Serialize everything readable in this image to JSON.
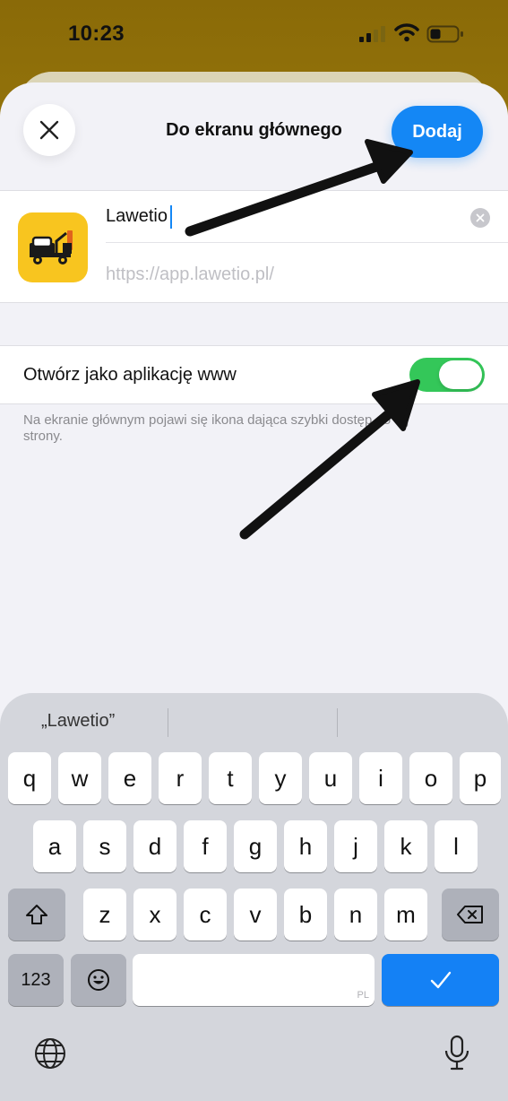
{
  "status_bar": {
    "time": "10:23",
    "signal_icon": "cellular-signal-icon",
    "wifi_icon": "wifi-icon",
    "battery_icon": "battery-icon",
    "battery_level": 0.3
  },
  "header": {
    "title": "Do ekranu głównego",
    "add_label": "Dodaj",
    "close_icon": "close-icon"
  },
  "app": {
    "icon": "tow-truck-icon",
    "name_value": "Lawetio",
    "url": "https://app.lawetio.pl/"
  },
  "toggle": {
    "label": "Otwórz jako aplikację www",
    "state": "on",
    "hint": "Na ekranie głównym pojawi się ikona dająca szybki dostęp do tej strony."
  },
  "keyboard": {
    "suggestions": [
      "„Lawetio”",
      "",
      ""
    ],
    "row1": [
      "q",
      "w",
      "e",
      "r",
      "t",
      "y",
      "u",
      "i",
      "o",
      "p"
    ],
    "row2": [
      "a",
      "s",
      "d",
      "f",
      "g",
      "h",
      "j",
      "k",
      "l"
    ],
    "row3": [
      "z",
      "x",
      "c",
      "v",
      "b",
      "n",
      "m"
    ],
    "numbers_label": "123",
    "space_tag": "PL",
    "shift_icon": "shift-icon",
    "backspace_icon": "backspace-icon",
    "emoji_icon": "emoji-icon",
    "return_icon": "checkmark-icon",
    "globe_icon": "globe-icon",
    "mic_icon": "microphone-icon"
  },
  "colors": {
    "accent": "#1487f5",
    "toggle_on": "#34c759",
    "annotation_arrow": "#111111"
  }
}
